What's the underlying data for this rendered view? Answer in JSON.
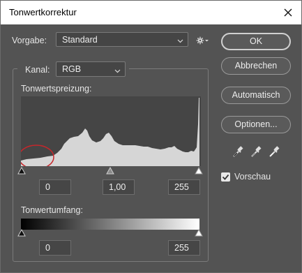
{
  "window": {
    "title": "Tonwertkorrektur"
  },
  "preset": {
    "label": "Vorgabe:",
    "value": "Standard",
    "options_icon": "gear-icon"
  },
  "channel": {
    "label": "Kanal:",
    "value": "RGB"
  },
  "input_levels": {
    "label": "Tonwertspreizung:",
    "black": "0",
    "gamma": "1,00",
    "white": "255"
  },
  "output_levels": {
    "label": "Tonwertumfang:",
    "black": "0",
    "white": "255"
  },
  "buttons": {
    "ok": "OK",
    "cancel": "Abbrechen",
    "auto": "Automatisch",
    "options": "Optionen..."
  },
  "eyedroppers": [
    "black-point-eyedropper-icon",
    "gray-point-eyedropper-icon",
    "white-point-eyedropper-icon"
  ],
  "preview": {
    "label": "Vorschau",
    "checked": true
  },
  "colors": {
    "dialog_bg": "#535353",
    "histogram_bg": "#454545",
    "histogram_fill": "#d6d6d6",
    "annotation_red": "#c8262b"
  }
}
